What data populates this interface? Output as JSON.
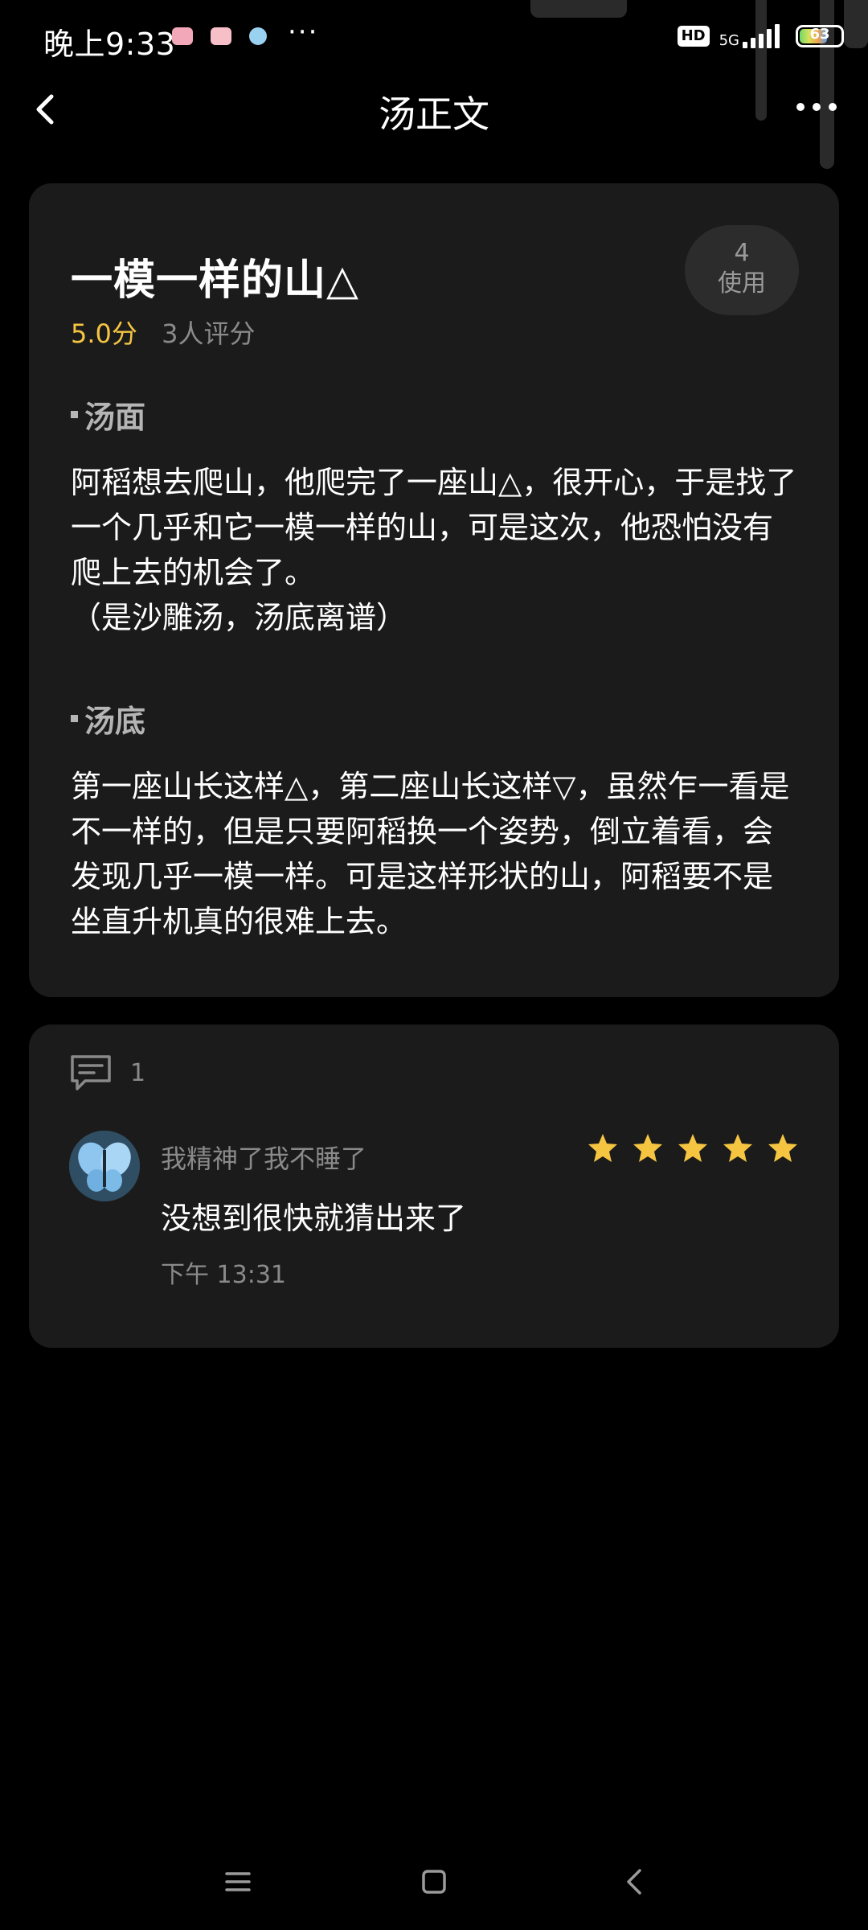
{
  "status_bar": {
    "time": "晚上9:33",
    "more": "···",
    "hd": "HD",
    "network": "5G",
    "battery": "63"
  },
  "nav": {
    "title": "汤正文"
  },
  "puzzle": {
    "title": "一模一样的山△",
    "usage_count": "4",
    "usage_label": "使用",
    "score": "5.0分",
    "raters": "3人评分",
    "surface_heading": "汤面",
    "surface_text": "阿稻想去爬山，他爬完了一座山△，很开心，于是找了一个几乎和它一模一样的山，可是这次，他恐怕没有爬上去的机会了。\n（是沙雕汤，汤底离谱）",
    "answer_heading": "汤底",
    "answer_text": "第一座山长这样△，第二座山长这样▽，虽然乍一看是不一样的，但是只要阿稻换一个姿势，倒立着看，会发现几乎一模一样。可是这样形状的山，阿稻要不是坐直升机真的很难上去。"
  },
  "comments": {
    "count": "1",
    "items": [
      {
        "username": "我精神了我不睡了",
        "text": "没想到很快就猜出来了",
        "time": "下午 13:31",
        "stars": 5
      }
    ]
  },
  "colors": {
    "background": "#000000",
    "card": "#1b1b1b",
    "score": "#f5c542",
    "star": "#f5c542",
    "muted": "#8a8a8a"
  },
  "icons": [
    "back-icon",
    "more-menu-icon",
    "comment-icon",
    "star-icon",
    "avatar-butterfly",
    "home-icon",
    "recent-apps-icon",
    "system-back-icon"
  ]
}
